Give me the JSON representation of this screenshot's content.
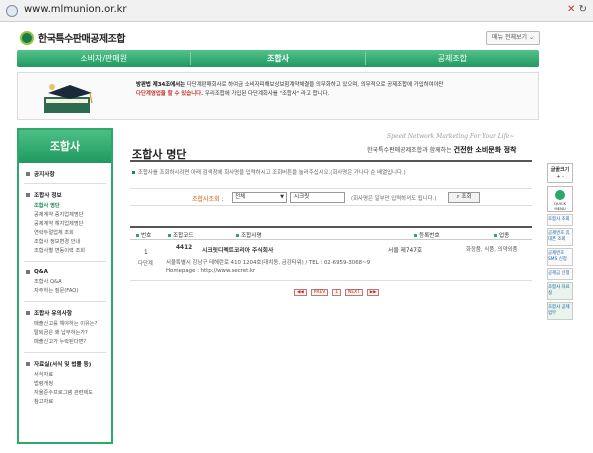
{
  "browser": {
    "url": "www.mlmunion.or.kr"
  },
  "header": {
    "logo_text": "한국특수판매공제조합",
    "menu_button": "메뉴 전체보기"
  },
  "nav": {
    "items": [
      "소비자/판매원",
      "조합사",
      "공제조합"
    ],
    "active_index": 1
  },
  "banner": {
    "line1_strong": "방판법 제34조에서는",
    "line1_rest": "다단계판매회사로 하여금 소비자피해보상보험계약체결을 의무화하고 있으며, 의무적으로 공제조합에 가입하여야만",
    "line2_strong": "다단계영업을 할 수 있습니다.",
    "line2_rest": "우리조합에 가입된 다단계회사를 \"조합사\" 라고 합니다."
  },
  "sidebar": {
    "title": "조합사",
    "sections": [
      {
        "label": "공지사항",
        "items": []
      },
      {
        "label": "조합사 정보",
        "items": [
          "조합사 명단",
          "공제계약 중지업체명단",
          "공제계약 해지업체명단",
          "연락두절업체 조회",
          "조합사 정보변경 안내",
          "조합사별 변동이력 조회"
        ],
        "current": 0
      },
      {
        "label": "Q&A",
        "items": [
          "조합사 Q&A",
          "자주하는 질문(FAQ)"
        ]
      },
      {
        "label": "조합사 유의사항",
        "items": [
          "매출신고를 해야하는 이유는?",
          "탈퇴금은 왜 납부하는가?",
          "매출신고가 누락된다면?"
        ]
      },
      {
        "label": "자료실(서식 및 법률 등)",
        "items": [
          "서식자료",
          "법령개정",
          "자율준수프로그램 관련제도",
          "참고자료"
        ]
      }
    ]
  },
  "main": {
    "title": "조합사 명단",
    "slogan_en": "Speed Network Marketing For Your Life~",
    "slogan_pre": "한국특수판매공제조합과 함께하는",
    "slogan_strong": "건전한 소비문화 정착",
    "notice": "조합사를 조회하시려면 아래 검색창에 회사명을 입력하시고 조회버튼을 눌러주십시오.(회사명은 가나다 순 배열입니다.)",
    "search": {
      "label": "조합사조회 :",
      "select_value": "전체",
      "input_value": "시크릿",
      "hint": "(회사명은 일부만 입력하셔도 됩니다.)",
      "button": "조회"
    },
    "table": {
      "headers": [
        "번호",
        "조합코드",
        "조합사명",
        "등록번호",
        "업종"
      ],
      "rows": [
        {
          "no": "1",
          "type": "다단계",
          "code": "4412",
          "name": "시크릿디렉트코리아 주식회사",
          "reg": "서울 제747호",
          "biz": "화장품, 식품, 의약외품",
          "address": "서울특별시 강남구 테헤란로 410 1204호(대치동, 금강타워) / TEL : 02-6959-3068~9",
          "homepage": "Homepage : http://www.secret.kr"
        }
      ]
    },
    "pager": [
      "◀◀",
      "PREV",
      "1",
      "NEXT",
      "▶▶"
    ]
  },
  "quick": {
    "font_label": "글꼴크기",
    "font_ctrl": "+  -",
    "menu_label": "QUICK MENU",
    "items": [
      "조합사 조회",
      "공제번호 휴대폰 조회",
      "공제번호 SMS 신청",
      "공제금 신청",
      "조합사 자료실",
      "조합사 공제업무"
    ]
  },
  "colors": {
    "brand_green": "#1f9a61",
    "accent_orange": "#d35400"
  }
}
